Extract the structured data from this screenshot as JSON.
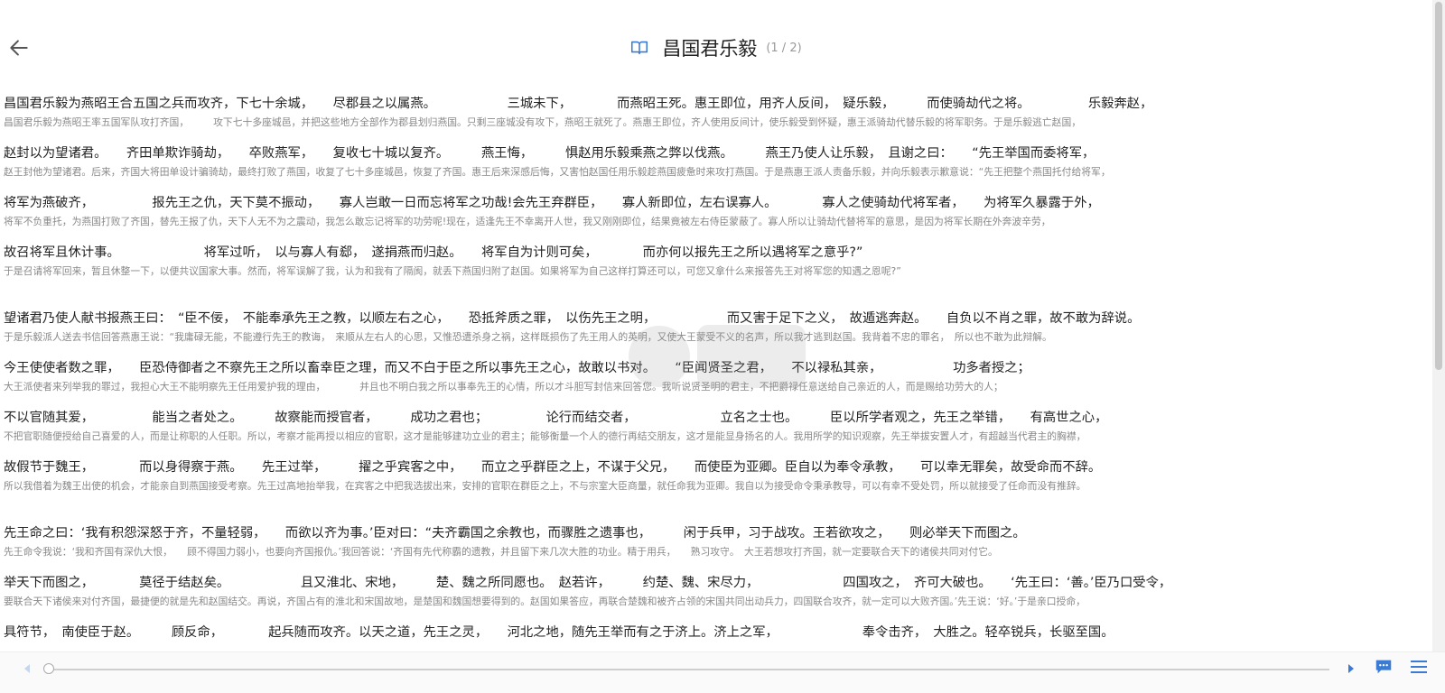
{
  "header": {
    "title": "昌国君乐毅",
    "page_info": "(1 / 2)"
  },
  "paragraphs": [
    {
      "lines": [
        {
          "original": "昌国君乐毅为燕昭王合五国之兵而攻齐，下七十余城，　　尽郡县之以属燕。　　　　　　三城未下，　　　　而燕昭王死。惠王即位，用齐人反间，　疑乐毅，　　　而使骑劫代之将。　　　　　乐毅奔赵，",
          "translation": "昌国君乐毅为燕昭王率五国军队攻打齐国，　　　攻下七十多座城邑，并把这些地方全部作为郡县划归燕国。只剩三座城没有攻下，燕昭王就死了。燕惠王即位，齐人使用反间计，使乐毅受到怀疑，惠王派骑劫代替乐毅的将军职务。于是乐毅逃亡赵国，"
        },
        {
          "original": "赵封以为望诸君。　　齐田单欺诈骑劫，　　卒败燕军，　　复收七十城以复齐。　　　燕王悔，　　　惧赵用乐毅乘燕之弊以伐燕。　　　燕王乃使人让乐毅，　且谢之曰：　　“先王举国而委将军，",
          "translation": "赵王封他为望诸君。后来，齐国大将田单设计骗骑劫，最终打败了燕国，收复了七十多座城邑，恢复了齐国。惠王后来深感后悔，又害怕赵国任用乐毅趁燕国疲惫时来攻打燕国。于是燕惠王派人责备乐毅，并向乐毅表示歉意说：“先王把整个燕国托付给将军，"
        },
        {
          "original": "将军为燕破齐，　　　　　报先王之仇，天下莫不振动，　　寡人岂敢一日而忘将军之功哉!会先王弃群臣，　　寡人新即位，左右误寡人。　　　　寡人之使骑劫代将军者，　　为将军久暴露于外，",
          "translation": "将军不负重托，为燕国打败了齐国，替先王报了仇，天下人无不为之震动，我怎么敢忘记将军的功劳呢!现在，适逢先王不幸离开人世，我又刚刚即位，结果竟被左右侍臣蒙蔽了。寡人所以让骑劫代替将军的意思，是因为将军长期在外奔波辛劳，"
        },
        {
          "original": "故召将军且休计事。　　　　　　　将军过听，　以与寡人有郄，　遂捐燕而归赵。　　将军自为计则可矣，　　　　而亦何以报先王之所以遇将军之意乎?”",
          "translation": "于是召请将军回来，暂且休整一下，以便共议国家大事。然而，将军误解了我，认为和我有了隔阂，就丢下燕国归附了赵国。如果将军为自己这样打算还可以，可您又拿什么来报答先王对将军您的知遇之恩呢?”"
        }
      ]
    },
    {
      "lines": [
        {
          "original": "望诸君乃使人献书报燕王曰：　“臣不佞，　不能奉承先王之教，以顺左右之心，　　恐抵斧质之罪，　以伤先王之明，　　　　　　而又害于足下之义，　故遁逃奔赵。　　自负以不肖之罪，故不敢为辞说。",
          "translation": "于是乐毅派人送去书信回答燕惠王说：“我庸碌无能，不能遵行先王的教诲，　来顺从左右人的心思，又惟恐遭杀身之祸，这样既损伤了先王用人的英明，又使大王蒙受不义的名声，所以我才逃到赵国。我背着不忠的罪名，　所以也不敢为此辩解。"
        },
        {
          "original": "今王使使者数之罪，　　臣恐侍御者之不察先王之所以畜幸臣之理，而又不白于臣之所以事先王之心，故敢以书对。　　“臣闻贤圣之君，　　不以禄私其亲，　　　　　　功多者授之；",
          "translation": "大王派使者来列举我的罪过，我担心大王不能明察先王任用爱护我的理由，　　　　并且也不明白我之所以事奉先王的心情，所以才斗胆写封信来回答您。我听说贤圣明的君主，不把爵禄任意送给自己亲近的人，而是赐给功劳大的人；"
        },
        {
          "original": "不以官随其爱，　　　　　能当之者处之。　　　故察能而授官者，　　　成功之君也；　　　　　论行而结交者，　　　　　　　立名之士也。　　　臣以所学者观之，先王之举错，　　有高世之心，",
          "translation": "不把官职随便授给自己喜爱的人，而是让称职的人任职。所以，考察才能再授以相应的官职，这才是能够建功立业的君主；能够衡量一个人的德行再结交朋友，这才是能显身扬名的人。我用所学的知识观察，先王举拔安置人才，有超越当代君主的胸襟，"
        },
        {
          "original": "故假节于魏王，　　　　而以身得察于燕。　　先王过举，　　　擢之乎宾客之中，　　而立之乎群臣之上，不谋于父兄，　　而使臣为亚卿。臣自以为奉令承教，　　可以幸无罪矣，故受命而不辞。",
          "translation": "所以我借着为魏王出使的机会，才能亲自到燕国接受考察。先王过高地抬举我，在宾客之中把我选拔出来，安排的官职在群臣之上，不与宗室大臣商量，就任命我为亚卿。我自以为接受命令秉承教导，可以有幸不受处罚，所以就接受了任命而没有推辞。"
        }
      ]
    },
    {
      "lines": [
        {
          "original": "先王命之曰：‘我有积怨深怒于齐，不量轻弱，　　而欲以齐为事。’臣对曰：“夫齐霸国之余教也，而骤胜之遗事也，　　　闲于兵甲，习于战攻。王若欲攻之，　　则必举天下而图之。",
          "translation": "先王命令我说：‘我和齐国有深仇大恨，　　顾不得国力弱小，也要向齐国报仇。’我回答说：‘齐国有先代称霸的遗教，并且留下来几次大胜的功业。精于用兵，　　熟习攻守。　大王若想攻打齐国，就一定要联合天下的诸侯共同对付它。"
        },
        {
          "original": "举天下而图之，　　　　莫径于结赵矣。　　　　　　且又淮北、宋地，　　　楚、魏之所同愿也。　赵若许，　　　约楚、魏、宋尽力，　　　　　　　四国攻之，　齐可大破也。　　‘先王曰：‘善。’臣乃口受令，",
          "translation": "要联合天下诸侯来对付齐国，最捷便的就是先和赵国结交。再说，齐国占有的淮北和宋国故地，是楚国和魏国想要得到的。赵国如果答应，再联合楚魏和被齐占领的宋国共同出动兵力，四国联合攻齐，就一定可以大败齐国。’先王说：‘好。’于是亲口授命，"
        },
        {
          "original": "具符节，　南使臣于赵。　　　顾反命，　　　　起兵随而攻齐。以天之道，先王之灵，　　河北之地，随先王举而有之于济上。济上之军，　　　　　　　奉令击齐，　大胜之。轻卒锐兵，长驱至国。",
          "translation": ""
        }
      ]
    }
  ],
  "progress": 0.0
}
